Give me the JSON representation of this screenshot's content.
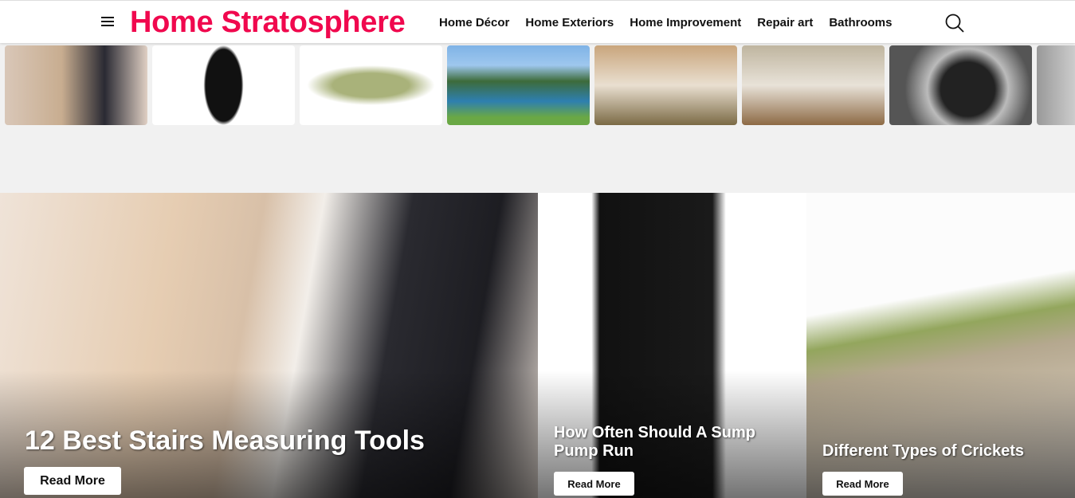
{
  "header": {
    "logo": "Home Stratosphere",
    "nav": [
      "Home Décor",
      "Home Exteriors",
      "Home Improvement",
      "Repair art",
      "Bathrooms"
    ]
  },
  "thumbnails": [
    {
      "subject": "man measuring stairs",
      "bg": "linear-gradient(90deg,#d9c7b8,#c8ad90 40%,#2a2a33 70%,#e0d0c4)"
    },
    {
      "subject": "sump pump",
      "bg": "radial-gradient(ellipse 25px 50px at 50% 50%,#111 90%,#fff 100%)"
    },
    {
      "subject": "grasshopper",
      "bg": "radial-gradient(ellipse 80px 25px at 50% 50%,#a9b27a 60%,#fff 100%)"
    },
    {
      "subject": "camper by lake",
      "bg": "linear-gradient(180deg,#7fb3e6 0%,#9ec7ee 25%,#3d6b3a 45%,#2e7fb0 70%,#6aa845 90%)"
    },
    {
      "subject": "japanese bedroom",
      "bg": "linear-gradient(180deg,#c9a57c,#e9dfd0 50%,#7b6a45)"
    },
    {
      "subject": "bed with headboard",
      "bg": "linear-gradient(180deg,#bfb59f,#e8e2d8 50%,#8d6a45)"
    },
    {
      "subject": "hard drive in hand",
      "bg": "radial-gradient(circle at 55% 55%,#222 30%,#bbb 45%,#555 70%)"
    },
    {
      "subject": "partial image",
      "bg": "linear-gradient(90deg,#999,#ccc)"
    }
  ],
  "featured": [
    {
      "title": "12 Best Stairs Measuring Tools",
      "button": "Read More"
    },
    {
      "title": "How Often Should A Sump Pump Run",
      "button": "Read More"
    },
    {
      "title": "Different Types of Crickets",
      "button": "Read More"
    }
  ]
}
